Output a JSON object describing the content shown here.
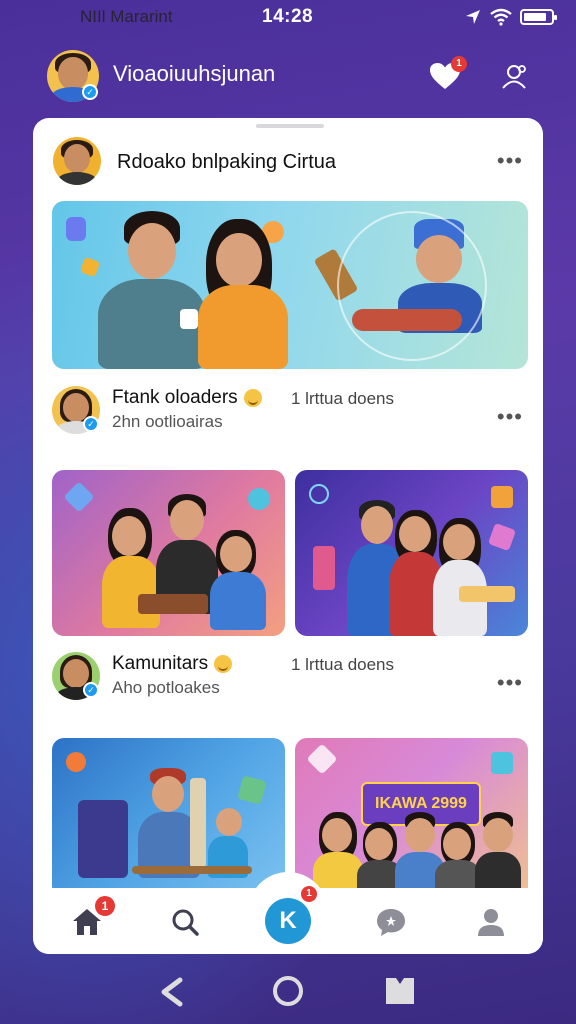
{
  "status_bar": {
    "carrier": "NIIl Mararint",
    "time": "14:28",
    "battery_level_percent": 85,
    "icons": [
      "location-arrow-icon",
      "wifi-icon",
      "battery-icon"
    ]
  },
  "header": {
    "title": "Vioaoiuuhsjunan",
    "notification_badge": "1",
    "icons": [
      "heart-icon",
      "profile-settings-icon"
    ]
  },
  "card": {
    "main_post": {
      "title": "Rdoako bnlpaking Cirtua"
    },
    "feed": [
      {
        "name": "Ftank oloaders",
        "meta": "1 lrttua doens",
        "subtitle": "2hn ootlioairas"
      },
      {
        "name": "Kamunitars",
        "meta": "1 lrttua doens",
        "subtitle": "Aho potloakes"
      }
    ],
    "tile_text": "IKAWA 2999"
  },
  "bottom_nav": {
    "items": [
      "home",
      "search",
      "k-create",
      "chat",
      "profile"
    ],
    "home_badge": "1",
    "center_label": "K",
    "center_badge": "1"
  },
  "colors": {
    "accent": "#2197d6",
    "badge": "#e53935",
    "background_top": "#4a2f9a",
    "background_bottom": "#3b2a80"
  }
}
